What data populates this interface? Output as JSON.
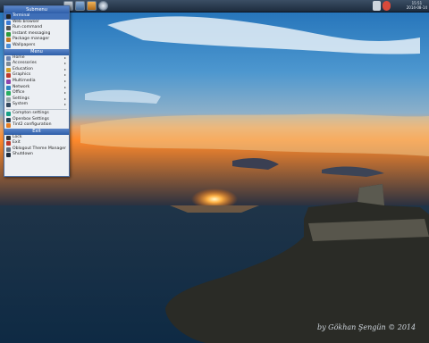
{
  "colors": {
    "accent": "#3f6fb8",
    "panel": "#2a3b50"
  },
  "panel": {
    "launchers": [
      "terminal-launcher",
      "file-manager-launcher",
      "web-browser-launcher",
      "text-editor-launcher",
      "image-viewer-launcher"
    ],
    "tray_time": "15:51",
    "tray_date": "2014-08-14"
  },
  "menu": {
    "title": "Submenu",
    "items": [
      {
        "label": "Terminal",
        "icon": "terminal-icon",
        "color": "#222"
      },
      {
        "label": "Web browser",
        "icon": "globe-icon",
        "color": "#3a7bd5"
      },
      {
        "label": "Run command",
        "icon": "gear-icon",
        "color": "#555"
      },
      {
        "label": "Instant messaging",
        "icon": "chat-icon",
        "color": "#2c9a3c"
      },
      {
        "label": "Package manager",
        "icon": "package-icon",
        "color": "#c07a2a"
      },
      {
        "label": "Wallpapers",
        "icon": "picture-icon",
        "color": "#4b8fd8"
      }
    ],
    "menu_header": "Menu",
    "categories": [
      {
        "label": "Home",
        "icon": "home-icon",
        "color": "#6c85b0"
      },
      {
        "label": "Accessories",
        "icon": "tools-icon",
        "color": "#7d8b99"
      },
      {
        "label": "Education",
        "icon": "education-icon",
        "color": "#d0a02a"
      },
      {
        "label": "Graphics",
        "icon": "graphics-icon",
        "color": "#c0392b"
      },
      {
        "label": "Multimedia",
        "icon": "multimedia-icon",
        "color": "#8e44ad"
      },
      {
        "label": "Network",
        "icon": "network-icon",
        "color": "#2e86c1"
      },
      {
        "label": "Office",
        "icon": "office-icon",
        "color": "#27ae60"
      },
      {
        "label": "Settings",
        "icon": "settings-icon",
        "color": "#95a5a6"
      },
      {
        "label": "System",
        "icon": "system-icon",
        "color": "#34495e"
      }
    ],
    "config": [
      {
        "label": "Compton settings",
        "icon": "compton-icon",
        "color": "#16a085"
      },
      {
        "label": "Openbox Settings",
        "icon": "openbox-icon",
        "color": "#2c3e50"
      },
      {
        "label": "Tint2 configuration",
        "icon": "tint2-icon",
        "color": "#e67e22"
      }
    ],
    "exit_header": "Exit",
    "exit_items": [
      {
        "label": "Lock",
        "icon": "lock-icon",
        "color": "#333"
      },
      {
        "label": "Exit",
        "icon": "exit-icon",
        "color": "#c0392b"
      },
      {
        "label": "Oblogout Theme Manager",
        "icon": "theme-icon",
        "color": "#5d6d7e"
      },
      {
        "label": "Shutdown",
        "icon": "power-icon",
        "color": "#1f2d3d"
      }
    ]
  },
  "wallpaper": {
    "signature": "by Gökhan Şengün © 2014"
  }
}
